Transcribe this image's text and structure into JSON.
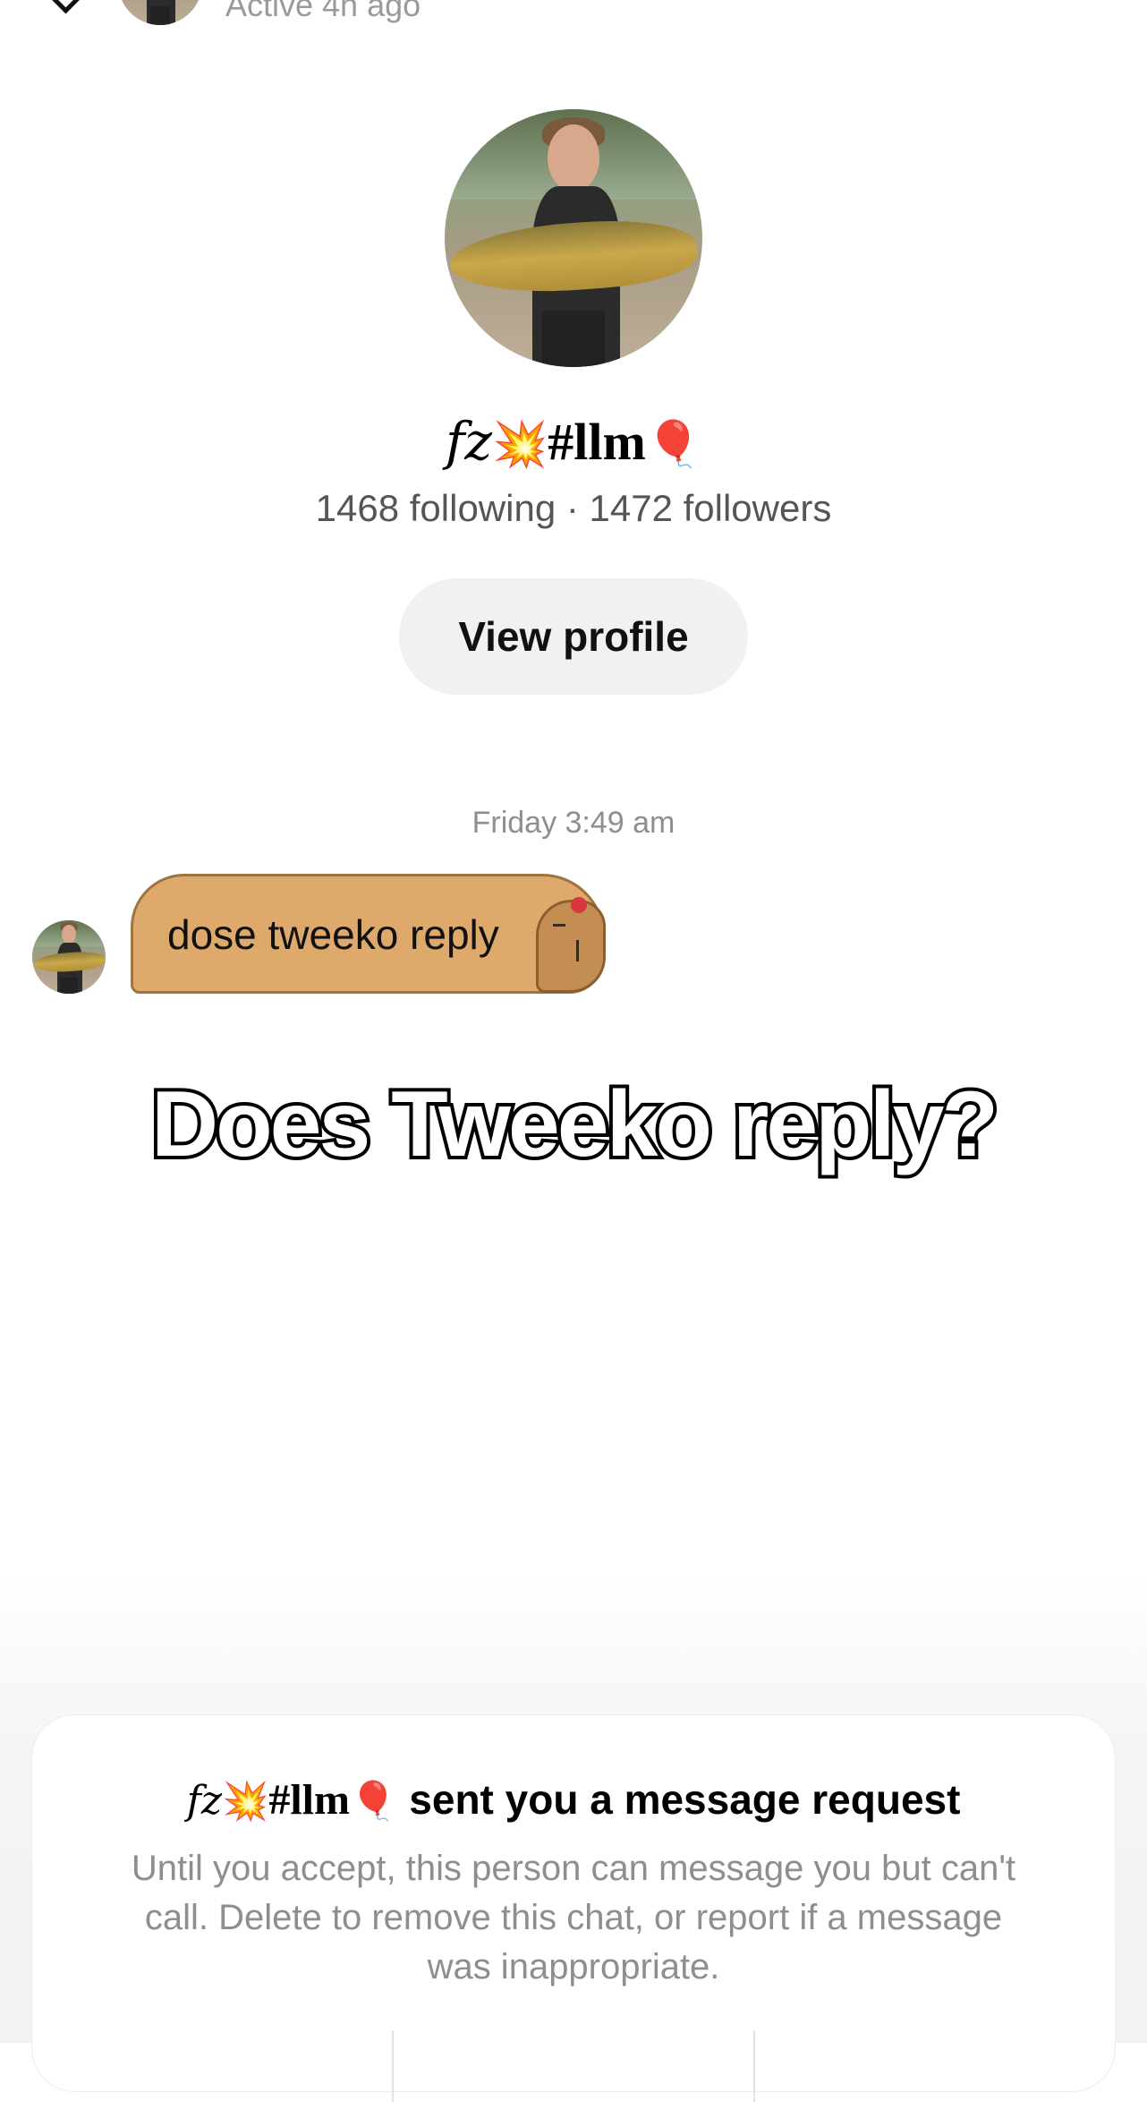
{
  "header": {
    "status": "Active 4h ago"
  },
  "profile": {
    "name_prefix": "fz",
    "name_emoji": "💥",
    "name_tag": "#llm",
    "name_suffix_emoji": "🎈",
    "stats": "1468 following · 1472 followers",
    "view_profile_label": "View profile"
  },
  "conversation": {
    "timestamp": "Friday 3:49 am",
    "messages": [
      {
        "text": "dose tweeko reply",
        "sticker": "capybara-icon"
      }
    ]
  },
  "caption": "Does Tweeko reply?",
  "request_card": {
    "name_prefix": "fz",
    "name_emoji": "💥",
    "name_tag": "#llm",
    "name_suffix_emoji": "🎈",
    "title_suffix": "sent you a message request",
    "description": "Until you accept, this person can message you but can't call. Delete to remove this chat, or report if a message was inappropriate."
  },
  "colors": {
    "bubble": "#deaa6c",
    "button_bg": "#f1f1f1",
    "muted_text": "#8e8e8e"
  }
}
